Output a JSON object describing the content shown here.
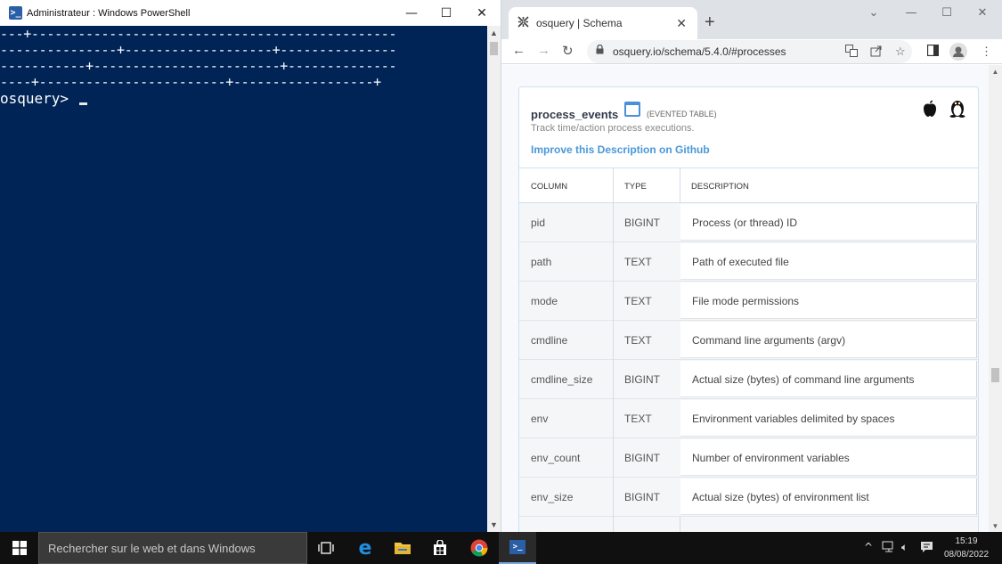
{
  "powershell": {
    "title": "Administrateur : Windows PowerShell",
    "lines": [
      "---+-----------------------------------------------",
      "---------------+-------------------+---------------",
      "-----------+------------------------+--------------",
      "----+------------------------+------------------+"
    ],
    "prompt": "osquery> ",
    "controls": {
      "minimize": "—",
      "maximize": "☐",
      "close": "✕"
    }
  },
  "browser": {
    "tab_title": "osquery | Schema",
    "tab_close": "✕",
    "new_tab": "+",
    "url": "osquery.io/schema/5.4.0/#processes",
    "window_controls": {
      "collapse": "⌄",
      "minimize": "—",
      "maximize": "☐",
      "close": "✕"
    },
    "nav": {
      "back": "←",
      "forward": "→",
      "reload": "↻"
    }
  },
  "schema": {
    "table_name": "process_events",
    "table_kind": "(EVENTED TABLE)",
    "description": "Track time/action process executions.",
    "improve_link": "Improve this Description on Github",
    "columns_header": {
      "column": "COLUMN",
      "type": "TYPE",
      "description": "DESCRIPTION"
    },
    "rows": [
      {
        "column": "pid",
        "type": "BIGINT",
        "description": "Process (or thread) ID"
      },
      {
        "column": "path",
        "type": "TEXT",
        "description": "Path of executed file"
      },
      {
        "column": "mode",
        "type": "TEXT",
        "description": "File mode permissions"
      },
      {
        "column": "cmdline",
        "type": "TEXT",
        "description": "Command line arguments (argv)"
      },
      {
        "column": "cmdline_size",
        "type": "BIGINT",
        "description": "Actual size (bytes) of command line arguments"
      },
      {
        "column": "env",
        "type": "TEXT",
        "description": "Environment variables delimited by spaces"
      },
      {
        "column": "env_count",
        "type": "BIGINT",
        "description": "Number of environment variables"
      },
      {
        "column": "env_size",
        "type": "BIGINT",
        "description": "Actual size (bytes) of environment list"
      }
    ]
  },
  "taskbar": {
    "search_placeholder": "Rechercher sur le web et dans Windows",
    "time": "15:19",
    "date": "08/08/2022",
    "colors": {
      "accent": "#7aa7e0",
      "background": "#101010"
    }
  }
}
